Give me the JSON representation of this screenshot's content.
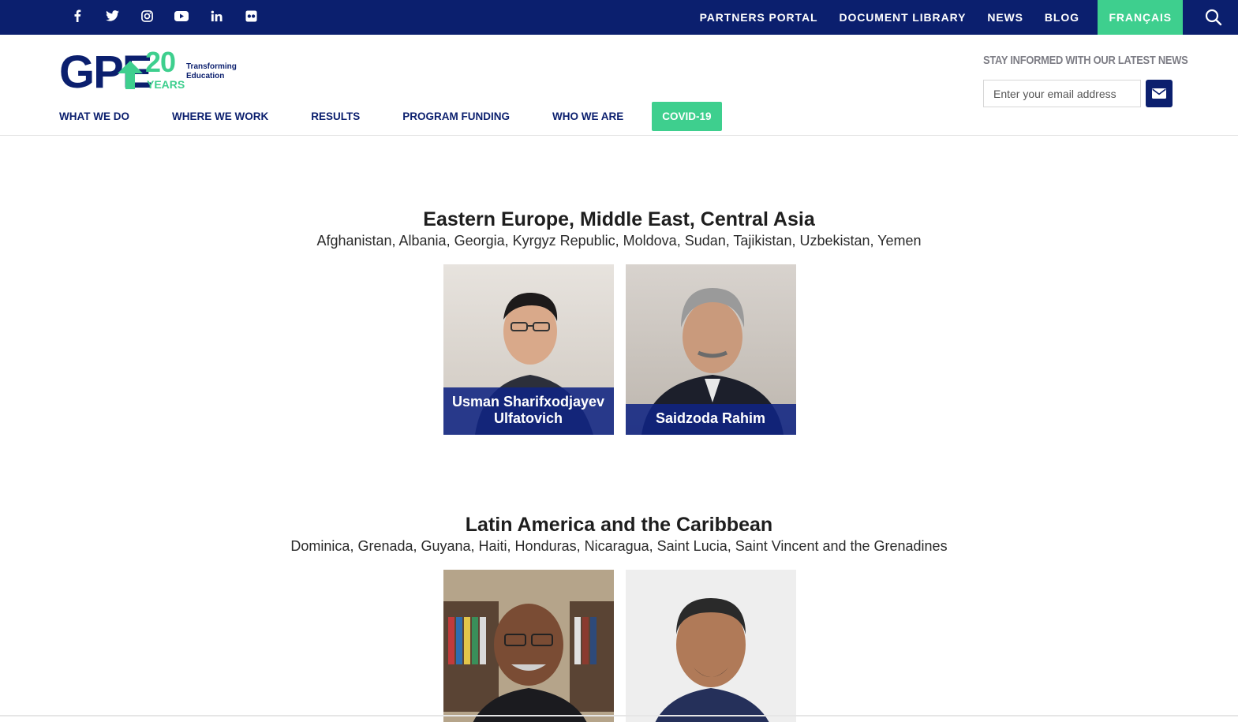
{
  "topbar": {
    "social_icons": [
      "facebook-icon",
      "twitter-icon",
      "instagram-icon",
      "youtube-icon",
      "linkedin-icon",
      "flickr-icon"
    ],
    "links": [
      "PARTNERS PORTAL",
      "DOCUMENT LIBRARY",
      "NEWS",
      "BLOG"
    ],
    "language": "FRANÇAIS",
    "search_icon": "search-icon"
  },
  "logo": {
    "letters": "GPE",
    "number": "20",
    "years": "YEARS",
    "tagline_1": "Transforming",
    "tagline_2": "Education"
  },
  "nav": {
    "items": [
      "WHAT WE DO",
      "WHERE WE WORK",
      "RESULTS",
      "PROGRAM FUNDING",
      "WHO WE ARE"
    ],
    "covid": "COVID-19"
  },
  "newsletter": {
    "label": "STAY INFORMED WITH OUR LATEST NEWS",
    "placeholder": "Enter your email address",
    "button_icon": "envelope-icon"
  },
  "regions": [
    {
      "title": "Eastern Europe, Middle East, Central Asia",
      "countries": "Afghanistan, Albania, Georgia, Kyrgyz Republic, Moldova, Sudan, Tajikistan, Uzbekistan, Yemen",
      "people": [
        {
          "name": "Usman Sharifxodjayev Ulfatovich"
        },
        {
          "name": "Saidzoda Rahim"
        }
      ]
    },
    {
      "title": "Latin America and the Caribbean",
      "countries": "Dominica, Grenada, Guyana, Haiti, Honduras, Nicaragua, Saint Lucia, Saint Vincent and the Grenadines",
      "people": [
        {
          "name": ""
        },
        {
          "name": ""
        }
      ]
    }
  ],
  "colors": {
    "navy": "#0b1f6e",
    "green": "#3ecf8e"
  }
}
